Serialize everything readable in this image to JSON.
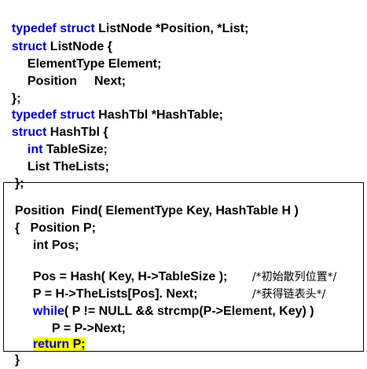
{
  "decl": {
    "l1": {
      "kw1": "typedef",
      "kw2": "struct",
      "rest": " ListNode *Position, *List;"
    },
    "l2": {
      "kw": "struct",
      "rest": " ListNode {"
    },
    "l3": {
      "text": "ElementType Element;"
    },
    "l4": {
      "type": "Position",
      "name": "Next;"
    },
    "l5": {
      "text": "};"
    },
    "l6": {
      "kw1": "typedef",
      "kw2": "struct",
      "rest": " HashTbl *HashTable;"
    },
    "l7": {
      "kw": "struct",
      "rest": " HashTbl {"
    },
    "l8": {
      "kw": "int",
      "rest": " TableSize;"
    },
    "l9": {
      "text": "List TheLists;"
    },
    "l10": {
      "text": "};"
    }
  },
  "func": {
    "f1": {
      "text": "Position  Find( ElementType Key, HashTable H )"
    },
    "f2": {
      "text": "{   Position P;"
    },
    "f3": {
      "text": "int Pos;"
    },
    "f4": {
      "code": "Pos = Hash( Key, H->TableSize );",
      "comment": "/*初始散列位置*/"
    },
    "f5": {
      "code": "P = H->TheLists[Pos]. Next;",
      "comment": "/*获得链表头*/"
    },
    "f6": {
      "kw": "while",
      "rest": "( P != NULL && strcmp(P->Element, Key) )"
    },
    "f7": {
      "text": "P = P->Next;"
    },
    "f8": {
      "kw": "return",
      "rest": " P;"
    },
    "f9": {
      "text": "}"
    }
  },
  "colors": {
    "keyword": "#0000cc",
    "highlight": "#ffff00",
    "text": "#000000"
  }
}
